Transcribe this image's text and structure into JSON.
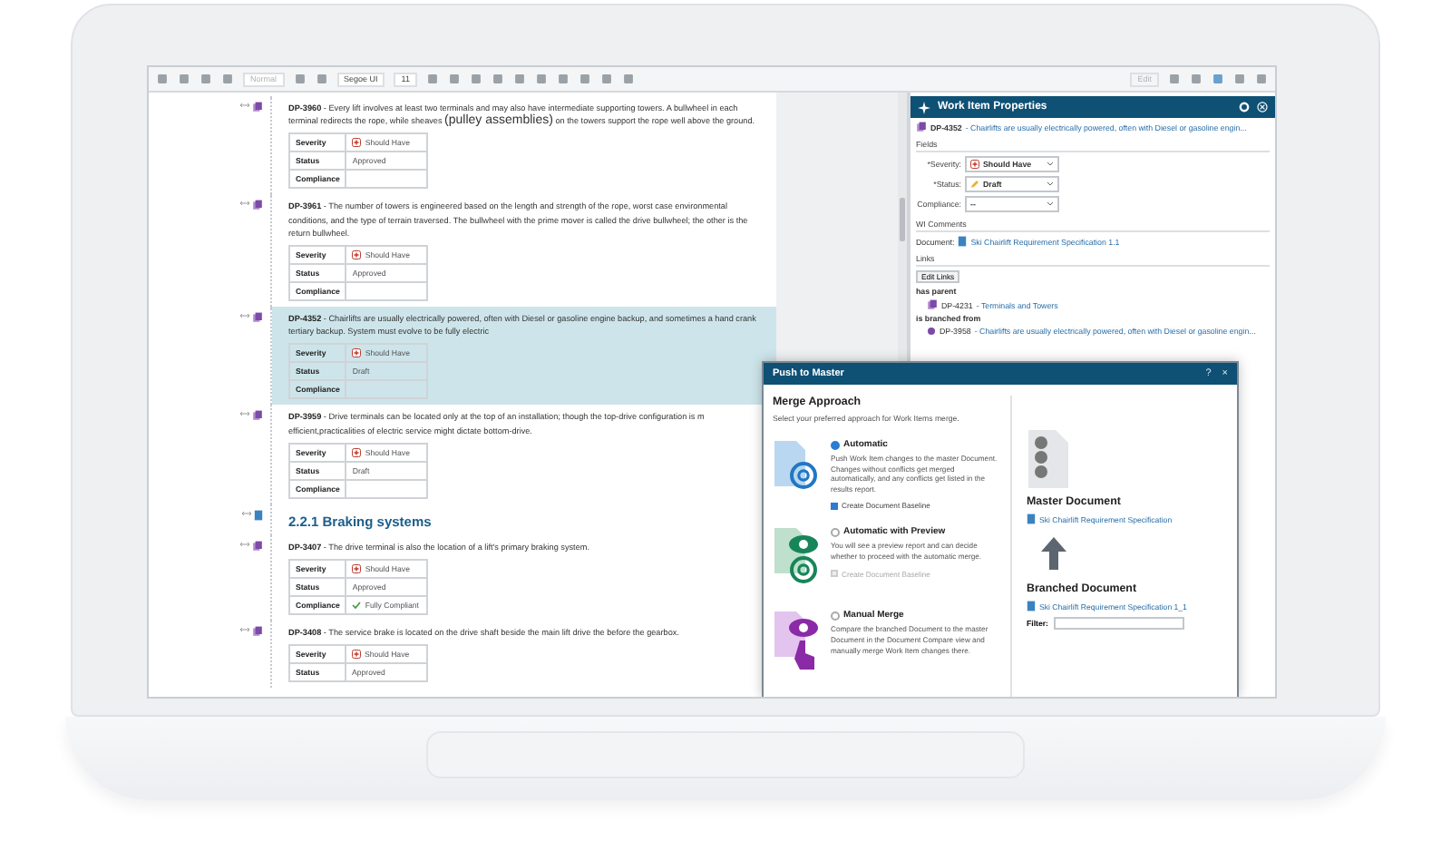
{
  "toolbar": {
    "style_field": {
      "value": "Normal",
      "disabled": true
    },
    "font_field": "Segoe UI",
    "size_field": "11",
    "edit_button": {
      "label": "Edit",
      "disabled": true
    }
  },
  "document": {
    "items": [
      {
        "kind": "work_item",
        "id": "DP-3960",
        "selected": false,
        "segments": [
          {
            "text": " - Every lift involves at least two terminals and may also have intermediate supporting towers. A bullwheel in each terminal redirects the rope, while sheaves "
          },
          {
            "text": "(pulley assemblies)",
            "large": true
          },
          {
            "text": " on the towers support the rope well above the ground."
          }
        ],
        "fields": [
          {
            "label": "Severity",
            "value": "Should Have",
            "kind": "severity"
          },
          {
            "label": "Status",
            "value": "Approved"
          },
          {
            "label": "Compliance"
          }
        ]
      },
      {
        "kind": "work_item",
        "id": "DP-3961",
        "selected": false,
        "segments": [
          {
            "text": " - The number of towers is engineered based on the length and strength of the rope, worst case environmental conditions, and the type of terrain traversed. The bullwheel with the prime mover is called the drive bullwheel; the other is the return bullwheel."
          }
        ],
        "fields": [
          {
            "label": "Severity",
            "value": "Should Have",
            "kind": "severity"
          },
          {
            "label": "Status",
            "value": "Approved"
          },
          {
            "label": "Compliance"
          }
        ]
      },
      {
        "kind": "work_item",
        "id": "DP-4352",
        "selected": true,
        "segments": [
          {
            "text": " - Chairlifts are usually electrically powered, often with Diesel or gasoline engine backup, and sometimes a hand crank tertiary backup. System must evolve to be fully electric"
          }
        ],
        "fields": [
          {
            "label": "Severity",
            "value": "Should Have",
            "kind": "severity"
          },
          {
            "label": "Status",
            "value": "Draft"
          },
          {
            "label": "Compliance"
          }
        ]
      },
      {
        "kind": "work_item",
        "id": "DP-3959",
        "selected": false,
        "segments": [
          {
            "text": " - Drive terminals can be located only  at the top of  an installation; though the top-drive configuration is m efficient,practicalities of electric service might dictate bottom-drive."
          }
        ],
        "fields": [
          {
            "label": "Severity",
            "value": "Should Have",
            "kind": "severity"
          },
          {
            "label": "Status",
            "value": "Draft"
          },
          {
            "label": "Compliance"
          }
        ]
      },
      {
        "kind": "heading",
        "text": "2.2.1 Braking systems"
      },
      {
        "kind": "work_item",
        "id": "DP-3407",
        "selected": false,
        "segments": [
          {
            "text": " - The drive terminal is also the location of a lift's primary braking system."
          }
        ],
        "fields": [
          {
            "label": "Severity",
            "value": "Should Have",
            "kind": "severity"
          },
          {
            "label": "Status",
            "value": "Approved"
          },
          {
            "label": "Compliance",
            "value": "Fully Compliant",
            "kind": "compliant"
          }
        ]
      },
      {
        "kind": "work_item",
        "id": "DP-3408",
        "selected": false,
        "segments": [
          {
            "text": " - The service brake is located on the drive shaft beside the main lift drive the before the gearbox."
          }
        ],
        "fields": [
          {
            "label": "Severity",
            "value": "Should Have",
            "kind": "severity"
          },
          {
            "label": "Status",
            "value": "Approved"
          }
        ]
      }
    ]
  },
  "panel": {
    "title": "Work Item Properties",
    "item": {
      "id": "DP-4352",
      "title": " - Chairlifts are usually electrically powered, often with Diesel or gasoline engin..."
    },
    "fields_heading": "Fields",
    "fields": [
      {
        "label": "*Severity:",
        "value": "Should Have",
        "kind": "severity"
      },
      {
        "label": "*Status:",
        "value": "Draft",
        "kind": "status"
      },
      {
        "label": "Compliance:",
        "value": "--"
      }
    ],
    "comments_heading": "WI Comments",
    "document_label": "Document:",
    "document_link": "Ski Chairlift Requirement Specification 1.1",
    "links_heading": "Links",
    "edit_links_button": "Edit Links",
    "links": [
      {
        "role": "has parent",
        "id": "DP-4231",
        "title": " - Terminals and Towers",
        "kind": "parent"
      },
      {
        "role": "is branched from",
        "id": "DP-3958",
        "title": " - Chairlifts are usually electrically powered, often with Diesel or gasoline engin...",
        "kind": "branch"
      }
    ]
  },
  "dialog": {
    "title": "Push to Master",
    "help": "?",
    "close": "×",
    "heading": "Merge Approach",
    "subtitle": "Select your preferred approach for Work Items merge.",
    "options": [
      {
        "kind": "automatic",
        "label": "Automatic",
        "selected": true,
        "description": "Push Work Item changes to the master Document. Changes without conflicts get merged automatically, and any conflicts get listed in the results report.",
        "baseline": {
          "label": "Create Document Baseline",
          "checked": true,
          "disabled": false
        }
      },
      {
        "kind": "preview",
        "label": "Automatic with Preview",
        "selected": false,
        "description": "You will see a preview report and can decide whether to proceed with the automatic merge.",
        "baseline": {
          "label": "Create Document Baseline",
          "checked": false,
          "disabled": true
        }
      },
      {
        "kind": "manual",
        "label": "Manual Merge",
        "selected": false,
        "description": "Compare the branched Document to the master Document in the Document Compare view and manually merge Work Item changes there."
      }
    ],
    "master_heading": "Master Document",
    "master_link": "Ski Chairlift Requirement Specification",
    "branched_heading": "Branched Document",
    "branched_link": "Ski Chairlift Requirement Specification 1_1",
    "filter_label": "Filter:"
  }
}
